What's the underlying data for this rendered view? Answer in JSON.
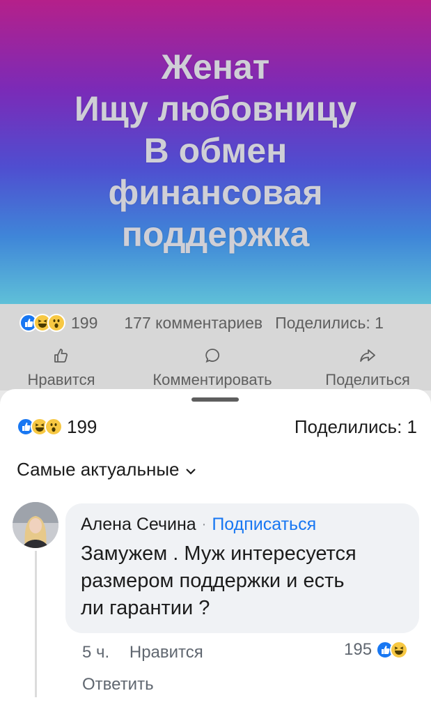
{
  "post": {
    "image_lines": [
      "Женат",
      "Ищу любовницу",
      "В обмен",
      "финансовая",
      "поддержка"
    ]
  },
  "stats": {
    "reactions_count": "199",
    "comments": "177 комментариев",
    "shares": "Поделились: 1"
  },
  "actions": {
    "like": "Нравится",
    "comment": "Комментировать",
    "share": "Поделиться"
  },
  "sheet": {
    "reactions_count": "199",
    "shares": "Поделились: 1",
    "sort_label": "Самые актуальные"
  },
  "comment": {
    "author": "Алена Сечина",
    "follow": "Подписаться",
    "text_lines": [
      "Замужем . Муж интересуется",
      "размером поддержки и есть",
      "ли гарантии ?"
    ],
    "time": "5 ч.",
    "like": "Нравится",
    "reply": "Ответить",
    "reaction_count": "195"
  },
  "colors": {
    "accent": "#1877f2",
    "like_reaction": "#1877f2",
    "haha_reaction": "#f7c843",
    "gradient_top": "#b5208a",
    "gradient_bottom": "#5fc0d8"
  },
  "icons": [
    "thumbs-up-icon",
    "comment-icon",
    "share-icon",
    "chevron-down-icon",
    "like-reaction-icon",
    "haha-reaction-icon",
    "wow-reaction-icon"
  ]
}
